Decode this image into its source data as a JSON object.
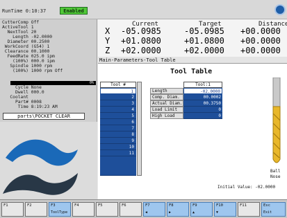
{
  "topbar": {
    "runtime": "RunTime 0:10:37",
    "status": "Enabled"
  },
  "status_panel": {
    "rows": [
      "CutterComp Off",
      "ActiveTool 1",
      "  NextTool 20",
      "    Length -02.0000",
      "  Diameter 00.2500",
      " WorkCoord (G54) 1",
      " Clearance 00.1000",
      "  FeedRate 025.0 ipm",
      "    (100%) 000.0 ipm",
      "   Spindle 1000 rpm",
      "    (100%) 1000 rpm Off"
    ],
    "bar_label": "0%",
    "rows2": [
      "     Cycle None",
      "     Dwell 000.0",
      "   Coolant",
      "     Part# 0008",
      "      Time 8:19:23 AM"
    ],
    "part_file": "parts\\POCKET CLEAR"
  },
  "dro": {
    "headers": [
      "Current",
      "Target",
      "Distance"
    ],
    "axes": [
      {
        "axis": "X",
        "current": "-05.0985",
        "target": "-05.0985",
        "distance": "+00.0000"
      },
      {
        "axis": "Y",
        "current": "+01.0800",
        "target": "+01.0800",
        "distance": "+00.0000"
      },
      {
        "axis": "Z",
        "current": "+02.0000",
        "target": "+02.0000",
        "distance": "+00.0000"
      }
    ]
  },
  "params": {
    "header": "Main-Parameters-Tool Table",
    "title": "Tool Table",
    "tool_col_header": "Tool #",
    "tools": [
      "1",
      "2",
      "3",
      "4",
      "5",
      "6",
      "7",
      "8",
      "9",
      "10",
      "11"
    ],
    "tool1_header": "Tool:1",
    "rows": [
      {
        "label": "Length",
        "value": "-02.0000"
      },
      {
        "label": "Comp. Diam.",
        "value": "00.0002"
      },
      {
        "label": "Actual Diam.",
        "value": "00.3750"
      },
      {
        "label": "Load Limit",
        "value": "0"
      },
      {
        "label": "High Load",
        "value": "0"
      }
    ],
    "tool_type": "Ball\nNose",
    "initial_value": "Initial Value: -02.0000"
  },
  "fkeys": [
    {
      "key": "F1",
      "sub": ""
    },
    {
      "key": "F2",
      "sub": ""
    },
    {
      "key": "F3",
      "sub": "ToolType"
    },
    {
      "key": "F4",
      "sub": ""
    },
    {
      "key": "F5",
      "sub": ""
    },
    {
      "key": "F6",
      "sub": ""
    },
    {
      "key": "F7",
      "sub": ""
    },
    {
      "key": "F8",
      "sub": ""
    },
    {
      "key": "F9",
      "sub": ""
    },
    {
      "key": "F10",
      "sub": ""
    },
    {
      "key": "F11",
      "sub": ""
    },
    {
      "key": "Esc",
      "sub": "Exit"
    }
  ],
  "colors": {
    "enabled": "#50c837",
    "table_blue": "#1e4f9a",
    "fkey_blue": "#9ec6ee"
  },
  "icons": {
    "top_right": "app-logo-icon",
    "tool_preview": "ball-nose-endmill-icon",
    "brand": "brand-logo-icon"
  }
}
